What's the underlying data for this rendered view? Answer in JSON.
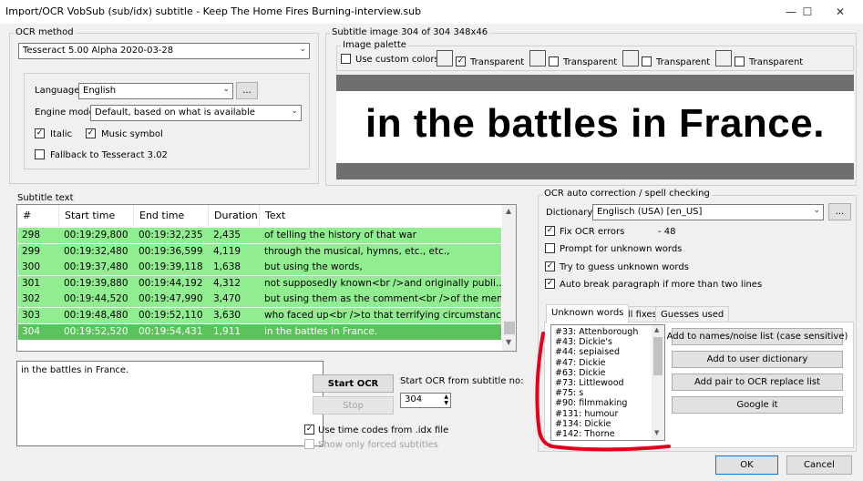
{
  "window": {
    "title": "Import/OCR VobSub (sub/idx) subtitle - Keep The Home Fires Burning-interview.sub",
    "minimize": "—",
    "maximize": "☐",
    "close": "✕"
  },
  "ocr_method": {
    "group_label": "OCR method",
    "engine_select": "Tesseract 5.00 Alpha 2020-03-28",
    "language_label": "Language",
    "language_value": "English",
    "language_more": "...",
    "engine_mode_label": "Engine mode",
    "engine_mode_value": "Default, based on what is available",
    "italic_label": "Italic",
    "italic_checked": true,
    "music_symbol_label": "Music symbol",
    "music_symbol_checked": true,
    "fallback_label": "Fallback to Tesseract 3.02",
    "fallback_checked": false
  },
  "subtitle_image": {
    "group_label": "Subtitle image 304 of 304   348x46",
    "palette_label": "Image palette",
    "use_custom_colors": "Use custom colors",
    "transparent_labels": [
      "Transparent",
      "Transparent",
      "Transparent",
      "Transparent"
    ],
    "transparent_checked": [
      true,
      false,
      false,
      false
    ],
    "preview_text": "in the battles in France."
  },
  "subtitle_text": {
    "group_label": "Subtitle text",
    "columns": [
      "#",
      "Start time",
      "End time",
      "Duration",
      "Text"
    ],
    "rows": [
      {
        "num": "298",
        "start": "00:19:29,800",
        "end": "00:19:32,235",
        "duration": "2,435",
        "text": "of telling the history of that war"
      },
      {
        "num": "299",
        "start": "00:19:32,480",
        "end": "00:19:36,599",
        "duration": "4,119",
        "text": "through the musical, hymns, etc., etc.,"
      },
      {
        "num": "300",
        "start": "00:19:37,480",
        "end": "00:19:39,118",
        "duration": "1,638",
        "text": "but using the words,"
      },
      {
        "num": "301",
        "start": "00:19:39,880",
        "end": "00:19:44,192",
        "duration": "4,312",
        "text": "not supposedly known<br />and originally publi..."
      },
      {
        "num": "302",
        "start": "00:19:44,520",
        "end": "00:19:47,990",
        "duration": "3,470",
        "text": "but using them as the comment<br />of the men"
      },
      {
        "num": "303",
        "start": "00:19:48,480",
        "end": "00:19:52,110",
        "duration": "3,630",
        "text": "who faced up<br />to that terrifying circumstance"
      },
      {
        "num": "304",
        "start": "00:19:52,520",
        "end": "00:19:54,431",
        "duration": "1,911",
        "text": "in the battles in France."
      }
    ],
    "selected_row": "304",
    "current_text": "in the battles in France."
  },
  "ocr_controls": {
    "start_ocr": "Start OCR",
    "stop": "Stop",
    "start_from_label": "Start OCR from subtitle no:",
    "start_from_value": "304",
    "use_time_codes": "Use time codes from .idx file",
    "use_time_codes_checked": true,
    "show_forced_only": "Show only forced subtitles",
    "show_forced_only_checked": false
  },
  "auto_correction": {
    "group_label": "OCR auto correction / spell checking",
    "dictionary_label": "Dictionary:",
    "dictionary_value": "Englisch (USA) [en_US]",
    "dictionary_more": "...",
    "fix_ocr_errors": "Fix OCR errors",
    "fix_ocr_errors_checked": true,
    "error_count": "- 48",
    "prompt_unknown": "Prompt for unknown words",
    "prompt_unknown_checked": false,
    "try_guess": "Try to guess unknown words",
    "try_guess_checked": true,
    "auto_break": "Auto break paragraph if more than two lines",
    "auto_break_checked": true
  },
  "tabs": {
    "unknown_words": "Unknown words",
    "all_fixes": "All fixes",
    "guesses_used": "Guesses used",
    "unknown_list": [
      "#33: Attenborough",
      "#43: Dickie's",
      "#44: sepiaised",
      "#47: Dickie",
      "#63: Dickie",
      "#73: Littlewood",
      "#75: s",
      "#90: filmmaking",
      "#131: humour",
      "#134: Dickie",
      "#142: Thorne"
    ],
    "add_names": "Add to names/noise list (case sensitive)",
    "add_user_dict": "Add to user dictionary",
    "add_pair": "Add pair to OCR replace list",
    "google_it": "Google it"
  },
  "footer": {
    "ok": "OK",
    "cancel": "Cancel"
  },
  "colors": {
    "row_green": "#90ee90",
    "row_selected": "#5cc25c",
    "annotation_red": "#e3001b"
  }
}
